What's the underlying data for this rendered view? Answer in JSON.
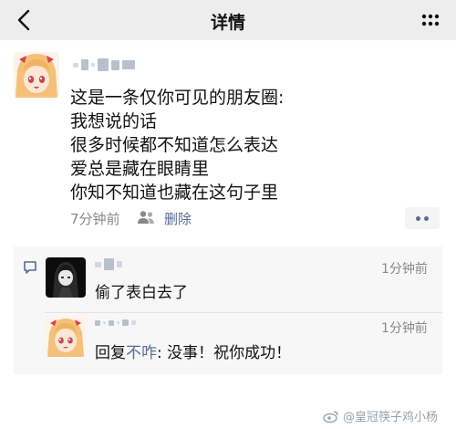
{
  "nav": {
    "title": "详情"
  },
  "post": {
    "lines": [
      "这是一条仅你可见的朋友圈:",
      "我想说的话",
      "很多时候都不知道怎么表达",
      "爱总是藏在眼睛里",
      "你知不知道也藏在这句子里"
    ],
    "time": "7分钟前",
    "delete_label": "删除"
  },
  "comments": [
    {
      "time": "1分钟前",
      "text": "偷了表白去了"
    },
    {
      "time": "1分钟前",
      "reply_prefix": "回复",
      "reply_to": "不咋",
      "reply_body": ": 没事！祝你成功！"
    }
  ],
  "watermark": {
    "text": "@皇冠筷子鸡小杨"
  },
  "colors": {
    "link": "#576b95",
    "nav_bg": "#ededed",
    "comment_bg": "#f7f7f7"
  }
}
